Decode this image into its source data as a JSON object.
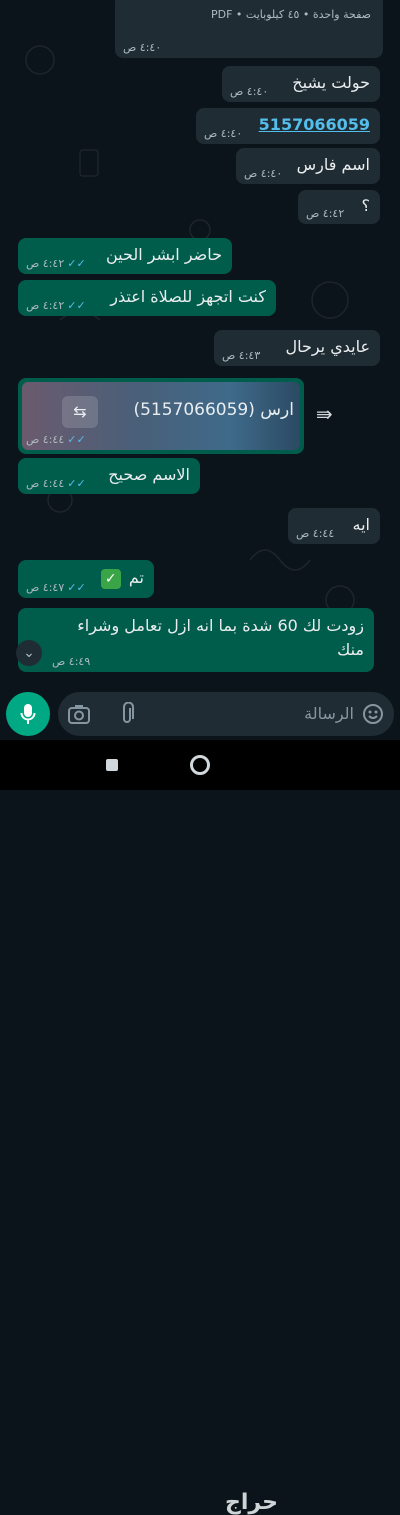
{
  "doc_message": {
    "meta": "صفحة واحدة • ٤٥ كيلوبايت • PDF",
    "time": "٤:٤٠ ص"
  },
  "messages": [
    {
      "text": "حولت يشيخ",
      "time": "٤:٤٠ ص"
    },
    {
      "text": "5157066059",
      "time": "٤:٤٠ ص"
    },
    {
      "text": "اسم فارس",
      "time": "٤:٤٠ ص"
    },
    {
      "text": "؟",
      "time": "٤:٤٢ ص"
    },
    {
      "text": "حاضر ابشر الحين",
      "time": "٤:٤٢ ص"
    },
    {
      "text": "كنت اتجهز للصلاة اعتذر",
      "time": "٤:٤٢ ص"
    },
    {
      "text": "عايدي يرحال",
      "time": "٤:٤٣ ص"
    },
    {
      "text": "ارس (5157066059)",
      "time": "٤:٤٤ ص"
    },
    {
      "text": "الاسم صحيح",
      "time": "٤:٤٤ ص"
    },
    {
      "text": "ايه",
      "time": "٤:٤٤ ص"
    },
    {
      "text": "تم",
      "time": "٤:٤٧ ص"
    },
    {
      "text": "زودت لك 60 شدة بما انه ازل تعامل وشراء",
      "text2": "منك",
      "time": "٤:٤٩ ص"
    }
  ],
  "composer": {
    "placeholder": "الرسالة"
  },
  "watermark": "حراج",
  "colors": {
    "incoming": "#202c33",
    "outgoing": "#005c4b",
    "accent": "#00a884",
    "ticks": "#53bdeb"
  },
  "icons": {
    "mic": "mic-icon",
    "camera": "camera-icon",
    "attach": "paperclip-icon",
    "emoji": "emoji-icon",
    "forward": "forward-icon",
    "scroll": "chevron-down-double-icon",
    "check": "check-mark-emoji"
  }
}
